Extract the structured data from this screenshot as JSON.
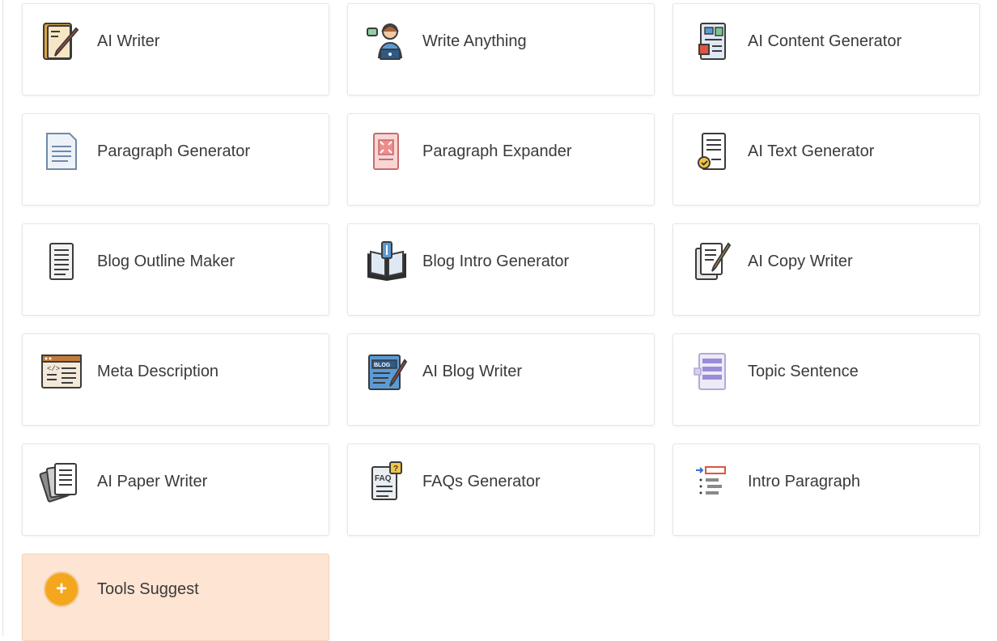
{
  "tools": [
    {
      "label": "AI Writer",
      "icon": "pencil-notepad-icon"
    },
    {
      "label": "Write Anything",
      "icon": "person-laptop-icon"
    },
    {
      "label": "AI Content Generator",
      "icon": "content-document-icon"
    },
    {
      "label": "Paragraph Generator",
      "icon": "document-lines-icon"
    },
    {
      "label": "Paragraph Expander",
      "icon": "expand-document-icon"
    },
    {
      "label": "AI Text Generator",
      "icon": "certified-document-icon"
    },
    {
      "label": "Blog Outline Maker",
      "icon": "outline-document-icon"
    },
    {
      "label": "Blog Intro Generator",
      "icon": "open-book-icon"
    },
    {
      "label": "AI Copy Writer",
      "icon": "papers-pen-icon"
    },
    {
      "label": "Meta Description",
      "icon": "code-window-icon"
    },
    {
      "label": "AI Blog Writer",
      "icon": "blog-pencil-icon"
    },
    {
      "label": "Topic Sentence",
      "icon": "scroll-list-icon"
    },
    {
      "label": "AI Paper Writer",
      "icon": "stacked-papers-icon"
    },
    {
      "label": "FAQs Generator",
      "icon": "faq-document-icon"
    },
    {
      "label": "Intro Paragraph",
      "icon": "indent-lines-icon"
    }
  ],
  "suggest": {
    "label": "Tools Suggest",
    "icon": "plus-icon",
    "icon_text": "+"
  },
  "colors": {
    "suggest_bg": "#fde4d3",
    "plus_bg": "#f4a71d"
  }
}
